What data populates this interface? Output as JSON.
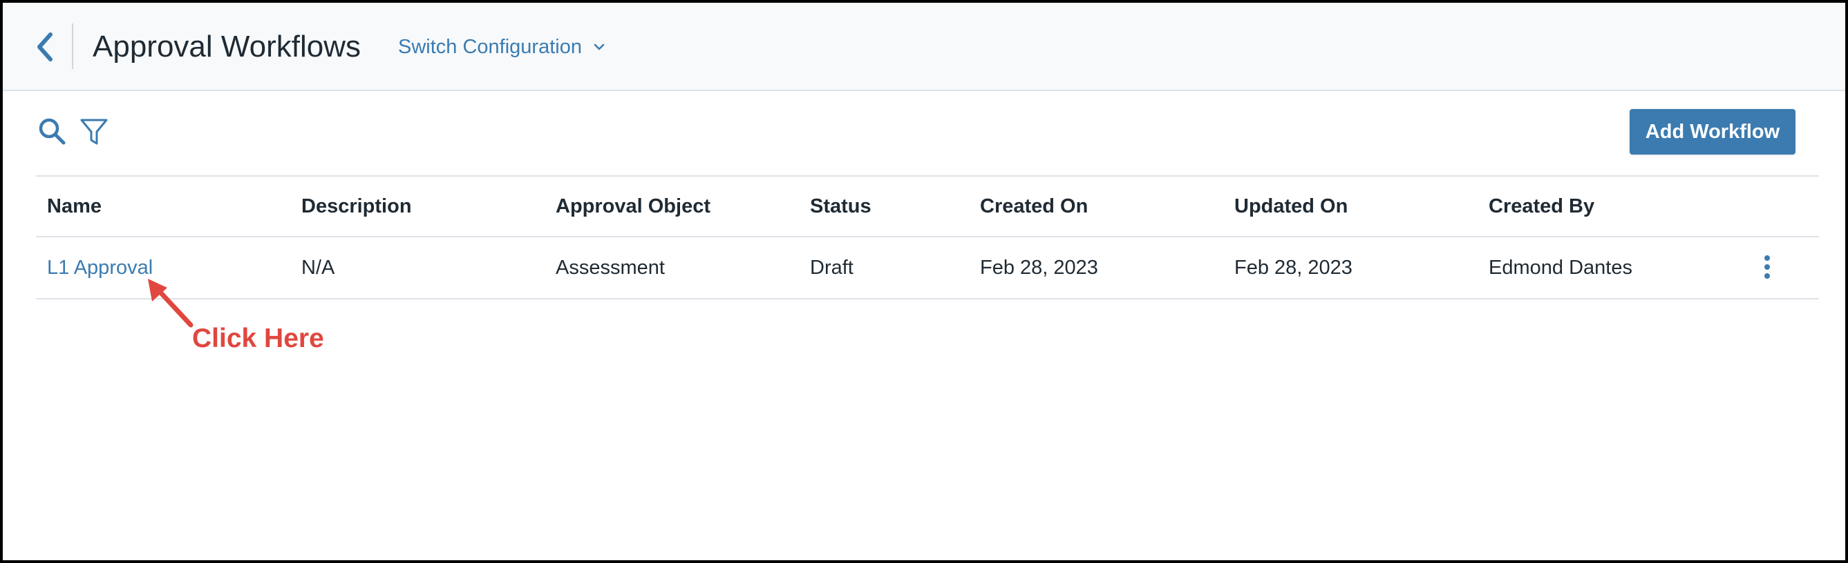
{
  "header": {
    "back_icon": "chevron-left-icon",
    "title": "Approval Workflows",
    "switch_configuration_label": "Switch Configuration",
    "switch_configuration_icon": "chevron-down-icon"
  },
  "toolbar": {
    "search_icon": "search-icon",
    "filter_icon": "filter-icon",
    "add_workflow_label": "Add Workflow"
  },
  "table": {
    "columns": [
      "Name",
      "Description",
      "Approval Object",
      "Status",
      "Created On",
      "Updated On",
      "Created By"
    ],
    "rows": [
      {
        "name": "L1 Approval",
        "description": "N/A",
        "approval_object": "Assessment",
        "status": "Draft",
        "created_on": "Feb 28, 2023",
        "updated_on": "Feb 28, 2023",
        "created_by": "Edmond Dantes",
        "actions_icon": "more-vertical-icon"
      }
    ]
  },
  "annotation": {
    "text": "Click Here",
    "color": "#e0473f"
  },
  "colors": {
    "accent": "#3b7bb0",
    "header_background": "#f7f9fb",
    "text": "#1f2a33",
    "border": "#dde3e8"
  }
}
